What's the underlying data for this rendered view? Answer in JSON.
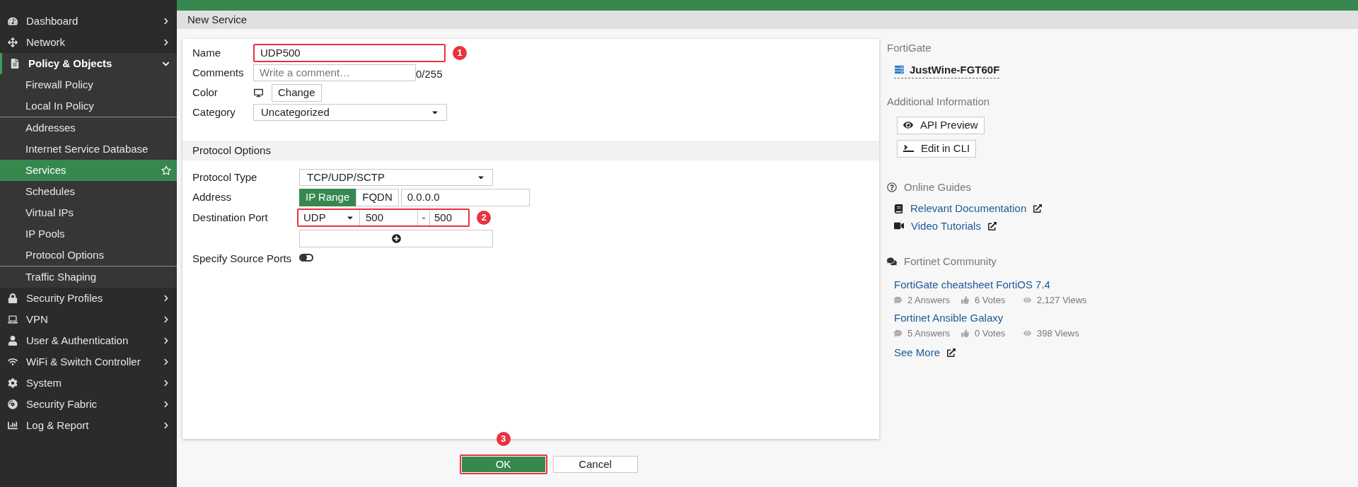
{
  "sidebar": {
    "items": [
      {
        "label": "Dashboard",
        "expanded": false
      },
      {
        "label": "Network",
        "expanded": false
      },
      {
        "label": "Policy & Objects",
        "expanded": true,
        "groups": [
          {
            "items": [
              {
                "label": "Firewall Policy",
                "selected": false
              },
              {
                "label": "Local In Policy",
                "selected": false
              }
            ]
          },
          {
            "items": [
              {
                "label": "Addresses",
                "selected": false
              },
              {
                "label": "Internet Service Database",
                "selected": false
              },
              {
                "label": "Services",
                "selected": true
              },
              {
                "label": "Schedules",
                "selected": false
              },
              {
                "label": "Virtual IPs",
                "selected": false
              },
              {
                "label": "IP Pools",
                "selected": false
              },
              {
                "label": "Protocol Options",
                "selected": false
              }
            ]
          },
          {
            "items": [
              {
                "label": "Traffic Shaping",
                "selected": false
              }
            ]
          }
        ]
      },
      {
        "label": "Security Profiles",
        "expanded": false
      },
      {
        "label": "VPN",
        "expanded": false
      },
      {
        "label": "User & Authentication",
        "expanded": false
      },
      {
        "label": "WiFi & Switch Controller",
        "expanded": false
      },
      {
        "label": "System",
        "expanded": false
      },
      {
        "label": "Security Fabric",
        "expanded": false
      },
      {
        "label": "Log & Report",
        "expanded": false
      }
    ]
  },
  "page_title": "New Service",
  "form": {
    "fields": [
      {
        "kind": "text",
        "label": "Name",
        "value": "UDP500",
        "callout": {
          "number": "1",
          "badge_above": false
        }
      },
      {
        "kind": "textarea",
        "label": "Comments",
        "placeholder": "Write a comment…",
        "counter": "0/255"
      },
      {
        "kind": "color",
        "label": "Color",
        "button": "Change"
      },
      {
        "kind": "select",
        "label": "Category",
        "value": "Uncategorized"
      }
    ],
    "protocol_section": {
      "title": "Protocol Options",
      "fields": [
        {
          "kind": "select",
          "label": "Protocol Type",
          "value": "TCP/UDP/SCTP"
        },
        {
          "kind": "address",
          "label": "Address",
          "options": [
            {
              "label": "IP Range",
              "selected": true
            },
            {
              "label": "FQDN",
              "selected": false
            }
          ],
          "value": "0.0.0.0"
        },
        {
          "kind": "port",
          "label": "Destination Port",
          "protocol": "UDP",
          "low": "500",
          "separator": "-",
          "high": "500",
          "callout": {
            "number": "2",
            "badge_above": false
          }
        },
        {
          "kind": "add"
        },
        {
          "kind": "toggle",
          "label": "Specify Source Ports",
          "on": false
        }
      ]
    }
  },
  "buttons": [
    {
      "kind": "primary",
      "label": "OK",
      "callout": {
        "number": "3",
        "badge_above": true
      }
    },
    {
      "kind": "secondary",
      "label": "Cancel"
    }
  ],
  "info_panel": {
    "fortigate": {
      "title": "FortiGate",
      "device": "JustWine-FGT60F"
    },
    "additional": {
      "title": "Additional Information",
      "buttons": [
        "API Preview",
        "Edit in CLI"
      ]
    },
    "guides": {
      "title": "Online Guides",
      "links": [
        "Relevant Documentation",
        "Video Tutorials"
      ]
    },
    "community": {
      "title": "Fortinet Community",
      "posts": [
        {
          "title": "FortiGate cheatsheet FortiOS 7.4",
          "answers": "2 Answers",
          "votes": "6 Votes",
          "views": "2,127 Views"
        },
        {
          "title": "Fortinet Ansible Galaxy",
          "answers": "5 Answers",
          "votes": "0 Votes",
          "views": "398 Views"
        }
      ],
      "see_more": "See More"
    }
  }
}
